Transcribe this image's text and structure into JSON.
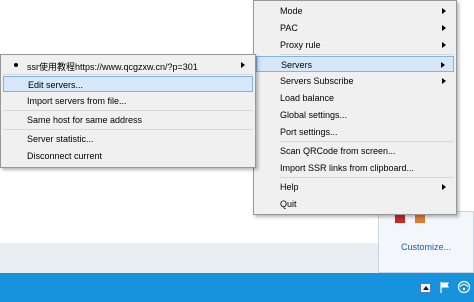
{
  "main_menu": {
    "items": [
      {
        "label": "Mode",
        "submenu": true
      },
      {
        "label": "PAC",
        "submenu": true
      },
      {
        "label": "Proxy rule",
        "submenu": true
      },
      {
        "label": "Servers",
        "submenu": true,
        "highlighted": true
      },
      {
        "label": "Servers Subscribe",
        "submenu": true
      },
      {
        "label": "Load balance",
        "submenu": false
      },
      {
        "label": "Global settings...",
        "submenu": false
      },
      {
        "label": "Port settings...",
        "submenu": false
      },
      {
        "label": "Scan QRCode from screen...",
        "submenu": false
      },
      {
        "label": "Import SSR links from clipboard...",
        "submenu": false
      },
      {
        "label": "Help",
        "submenu": true
      },
      {
        "label": "Quit",
        "submenu": false
      }
    ]
  },
  "servers_submenu": {
    "items": [
      {
        "label": "ssr使用教程https://www.qcgzxw.cn/?p=301",
        "checked": true,
        "submenu": true
      },
      {
        "label": "Edit servers...",
        "highlighted": true
      },
      {
        "label": "Import servers from file..."
      },
      {
        "label": "Same host for same address"
      },
      {
        "label": "Server statistic..."
      },
      {
        "label": "Disconnect current"
      }
    ]
  },
  "notification_area": {
    "customize_label": "Customize..."
  },
  "colors": {
    "menu_background": "#f0f0f0",
    "highlight_fill": "#d5e7f8",
    "highlight_border": "#7eb4ea",
    "taskbar": "#1693dc",
    "link": "#1a5fb4"
  }
}
